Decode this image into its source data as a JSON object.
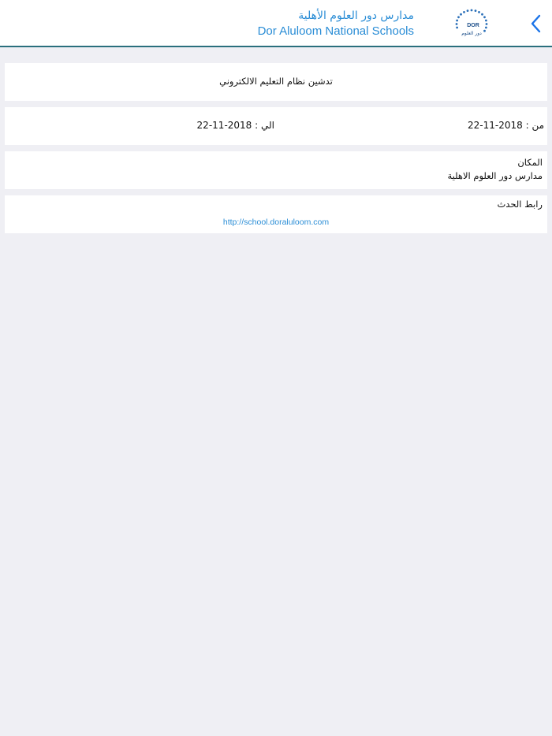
{
  "header": {
    "brand_ar": "مدارس دور العلوم الأهلية",
    "brand_en": "Dor Aluloom National Schools",
    "logo_text_en": "DOR",
    "logo_text_ar": "دور العلوم",
    "back_icon": "chevron-left-icon",
    "accent_color": "#2a8dd6",
    "border_color": "#2a6f7d"
  },
  "event": {
    "title": "تدشين نظام التعليم الالكتروني",
    "from": "من : 2018-11-22",
    "to": "الي : 2018-11-22",
    "location_label": "المكان",
    "location_value": "مدارس دور العلوم الاهلية",
    "link_label": "رابط الحدث",
    "link_value": "http://school.doraluloom.com"
  }
}
